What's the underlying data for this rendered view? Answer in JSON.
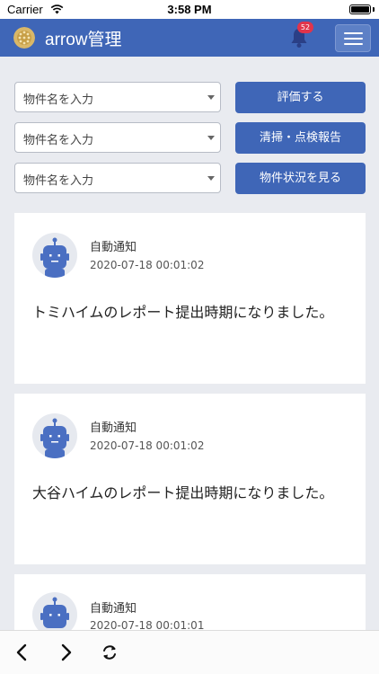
{
  "status_bar": {
    "carrier": "Carrier",
    "time": "3:58 PM"
  },
  "header": {
    "title": "arrow管理",
    "notification_count": "52",
    "brand_color": "#3f66b7",
    "badge_color": "#e0344b"
  },
  "controls": [
    {
      "placeholder": "物件名を入力",
      "button": "評価する"
    },
    {
      "placeholder": "物件名を入力",
      "button": "清掃・点検報告"
    },
    {
      "placeholder": "物件名を入力",
      "button": "物件状況を見る"
    }
  ],
  "notifications": [
    {
      "sender": "自動通知",
      "timestamp": "2020-07-18 00:01:02",
      "message": "トミハイムのレポート提出時期になりました。"
    },
    {
      "sender": "自動通知",
      "timestamp": "2020-07-18 00:01:02",
      "message": "大谷ハイムのレポート提出時期になりました。"
    },
    {
      "sender": "自動通知",
      "timestamp": "2020-07-18 00:01:01",
      "message": ""
    }
  ],
  "toolbar": {
    "icons": [
      "back-arrow-icon",
      "forward-arrow-icon",
      "reload-icon"
    ]
  }
}
